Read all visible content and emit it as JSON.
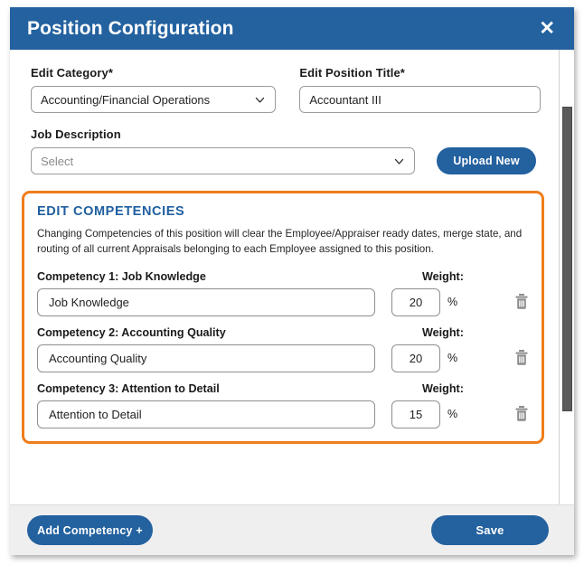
{
  "modal": {
    "title": "Position Configuration",
    "close_icon": "close-icon"
  },
  "form": {
    "category": {
      "label": "Edit Category*",
      "value": "Accounting/Financial Operations",
      "chevron_icon": "chevron-down-icon"
    },
    "position_title": {
      "label": "Edit Position Title*",
      "value": "Accountant III"
    },
    "job_description": {
      "label": "Job Description",
      "placeholder": "Select",
      "value": "",
      "chevron_icon": "chevron-down-icon"
    },
    "upload_button": "Upload New"
  },
  "competencies": {
    "heading": "EDIT COMPETENCIES",
    "note": "Changing Competencies of this position will clear the Employee/Appraiser ready dates, merge state, and routing of all current Appraisals belonging to each Employee assigned to this position.",
    "weight_label": "Weight:",
    "percent_symbol": "%",
    "delete_icon": "trash-icon",
    "items": [
      {
        "label": "Competency 1: Job Knowledge",
        "name": "Job Knowledge",
        "weight": "20"
      },
      {
        "label": "Competency 2: Accounting Quality",
        "name": "Accounting Quality",
        "weight": "20"
      },
      {
        "label": "Competency 3: Attention to Detail",
        "name": "Attention to Detail",
        "weight": "15"
      }
    ]
  },
  "footer": {
    "add_competency": "Add Competency +",
    "save": "Save"
  },
  "colors": {
    "header_blue": "#23619f",
    "accent_orange": "#ef7d1a",
    "section_heading_blue": "#1f5fa0",
    "footer_grey": "#efefef"
  }
}
